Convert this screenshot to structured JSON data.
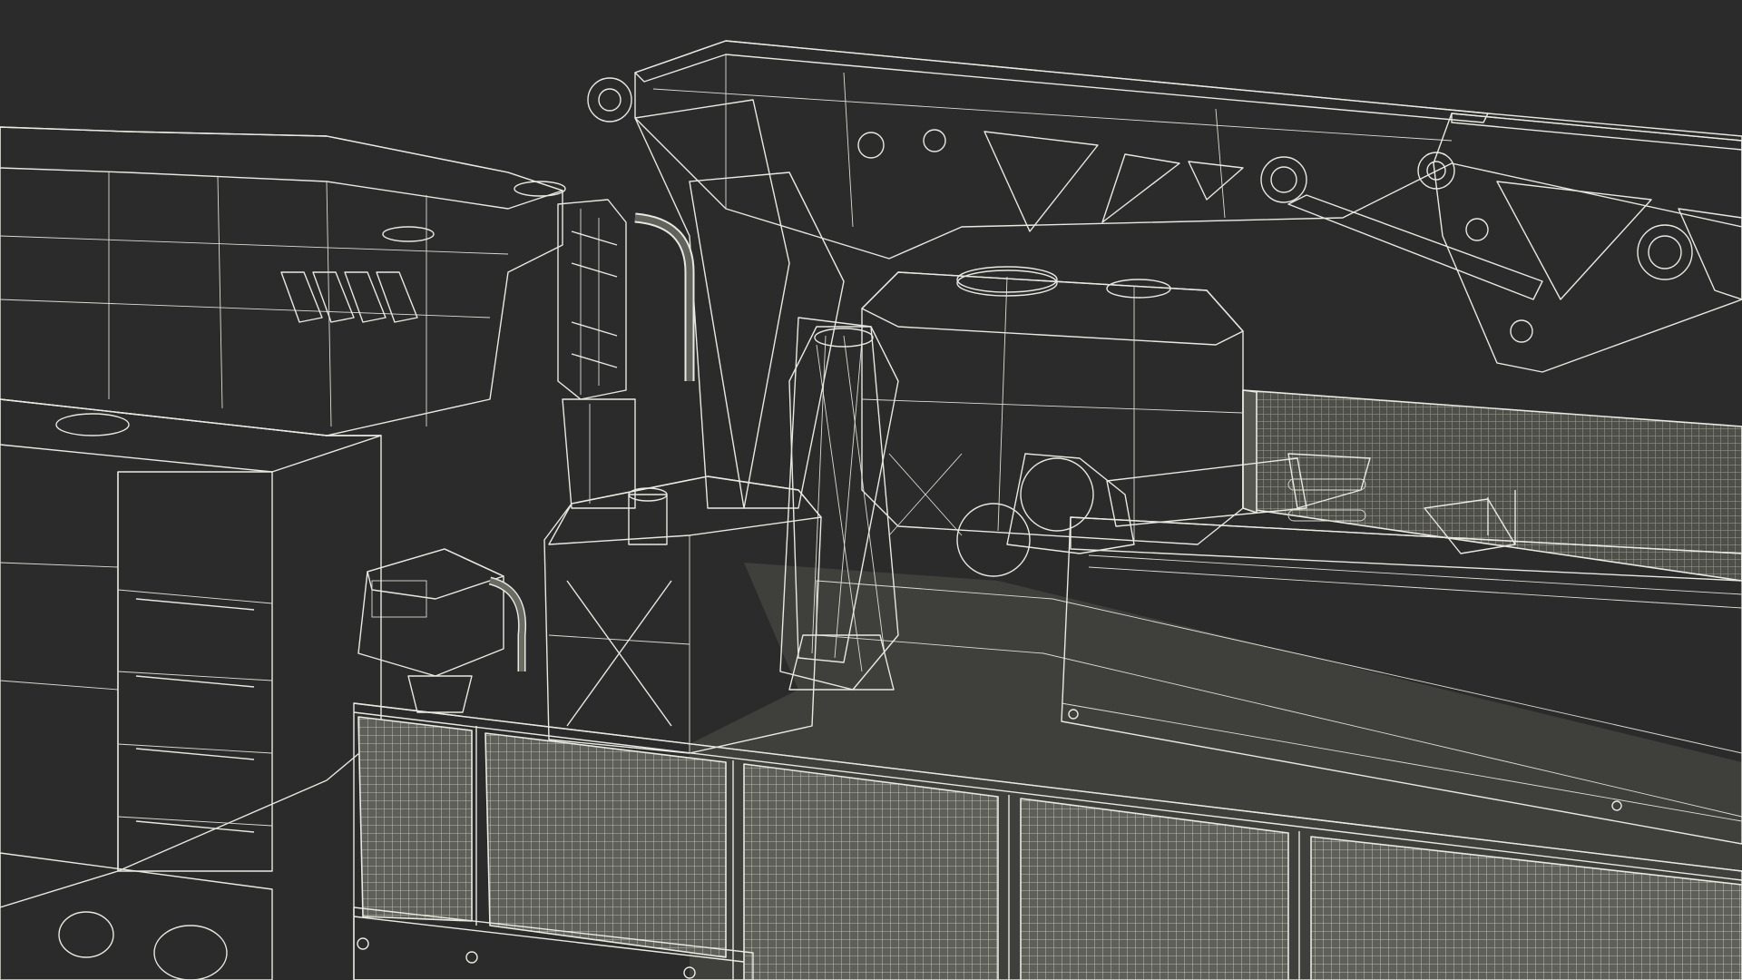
{
  "scene": {
    "subject": "wireframe-render",
    "background_color": "#2b2b2b",
    "surface_colors": {
      "light": "#6a6b63",
      "mid": "#5b5c55",
      "dark": "#4b4c46",
      "darker": "#3f403b",
      "wire": "#e9e9e2"
    },
    "mesh_grids": 5,
    "mesh_grids_back": 1
  }
}
